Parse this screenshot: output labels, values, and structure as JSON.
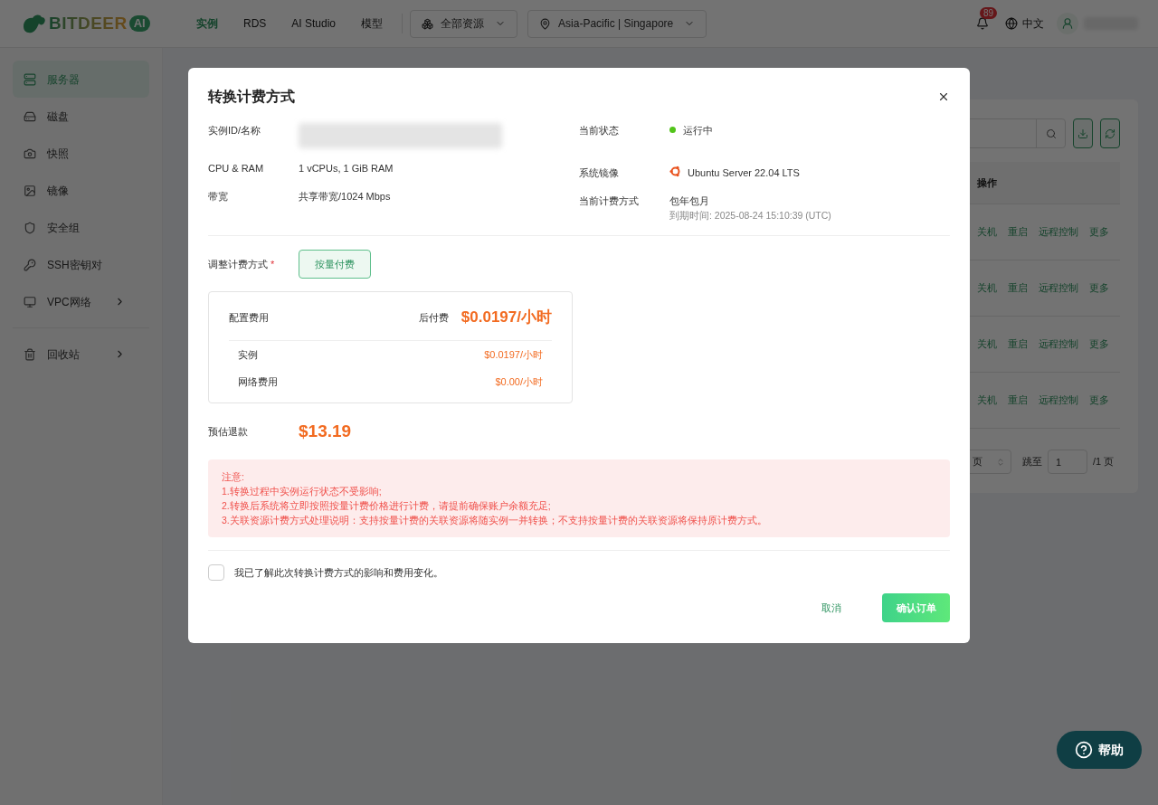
{
  "header": {
    "logo": {
      "brand": "BITDEER",
      "badge": "AI"
    },
    "nav": [
      {
        "label": "实例",
        "selected": true
      },
      {
        "label": "RDS",
        "selected": false
      },
      {
        "label": "AI Studio",
        "selected": false
      },
      {
        "label": "模型",
        "selected": false
      }
    ],
    "resource_select": "全部资源",
    "region_select": "Asia-Pacific | Singapore",
    "notifications": "89",
    "language": "中文"
  },
  "sidebar": {
    "items": [
      {
        "label": "服务器",
        "selected": true,
        "expandable": false
      },
      {
        "label": "磁盘",
        "selected": false,
        "expandable": false
      },
      {
        "label": "快照",
        "selected": false,
        "expandable": false
      },
      {
        "label": "镜像",
        "selected": false,
        "expandable": false
      },
      {
        "label": "安全组",
        "selected": false,
        "expandable": false
      },
      {
        "label": "SSH密钥对",
        "selected": false,
        "expandable": false
      },
      {
        "label": "VPC网络",
        "selected": false,
        "expandable": true
      }
    ],
    "bottom_items": [
      {
        "label": "回收站",
        "selected": false,
        "expandable": true
      }
    ]
  },
  "table": {
    "header": "操作",
    "rows": [
      {
        "actions": [
          "关机",
          "重启",
          "远程控制",
          "更多"
        ]
      },
      {
        "actions": [
          "关机",
          "重启",
          "远程控制",
          "更多"
        ]
      },
      {
        "actions": [
          "关机",
          "重启",
          "远程控制",
          "更多"
        ]
      },
      {
        "actions": [
          "关机",
          "重启",
          "远程控制",
          "更多"
        ]
      }
    ],
    "pagination": {
      "page_size": "页",
      "jump_label": "跳至",
      "jump_value": "1",
      "total": "/1 页"
    }
  },
  "dialog": {
    "title": "转换计费方式",
    "info_left": [
      {
        "label": "实例ID/名称",
        "kind": "blurred"
      },
      {
        "label": "CPU & RAM",
        "kind": "text",
        "value": "1 vCPUs, 1 GiB RAM"
      },
      {
        "label": "带宽",
        "kind": "text",
        "value": "共享带宽/1024 Mbps"
      }
    ],
    "info_right": [
      {
        "label": "当前状态",
        "kind": "status",
        "value": "运行中",
        "color": "#52c41a"
      },
      {
        "label": "系统镜像",
        "kind": "os",
        "value": "Ubuntu Server 22.04 LTS"
      },
      {
        "label": "当前计费方式",
        "kind": "billing",
        "value": "包年包月",
        "note": "到期时间: 2025-08-24 15:10:39 (UTC)"
      }
    ],
    "billing_label": "调整计费方式",
    "required_mark": "*",
    "billing_options": [
      {
        "label": "按量付费",
        "selected": true
      }
    ],
    "price": {
      "label": "配置费用",
      "type": "后付费",
      "total": "$0.0197/小时",
      "items": [
        {
          "label": "实例",
          "value": "$0.0197/小时"
        },
        {
          "label": "网络费用",
          "value": "$0.00/小时"
        }
      ]
    },
    "refund": {
      "label": "预估退款",
      "value": "$13.19"
    },
    "notice": [
      "注意:",
      "1.转换过程中实例运行状态不受影响;",
      "2.转换后系统将立即按照按量计费价格进行计费，请提前确保账户余额充足;",
      "3.关联资源计费方式处理说明：支持按量计费的关联资源将随实例一并转换；不支持按量计费的关联资源将保持原计费方式。"
    ],
    "agreement": {
      "label": "我已了解此次转换计费方式的影响和费用变化。",
      "checked": false
    },
    "cancel": "取消",
    "confirm": "确认订单"
  },
  "help": "帮助"
}
